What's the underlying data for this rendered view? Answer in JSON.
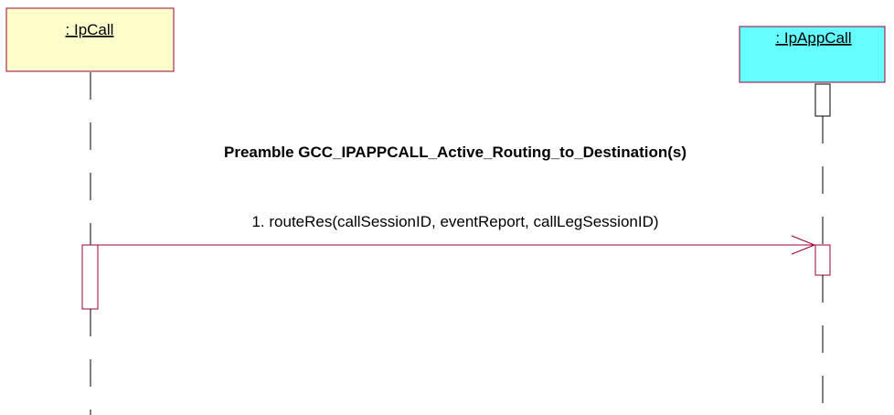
{
  "diagram": {
    "type": "sequence",
    "lifelines": [
      {
        "id": "ipcall",
        "label": ": IpCall",
        "fill_color": "#ffffcc"
      },
      {
        "id": "ipappcall",
        "label": ": IpAppCall",
        "fill_color": "#66ffff"
      }
    ],
    "note": {
      "text": "Preamble GCC_IPAPPCALL_Active_Routing_to_Destination(s)"
    },
    "messages": [
      {
        "label": "1. routeRes(callSessionID, eventReport, callLegSessionID)",
        "from": "ipcall",
        "to": "ipappcall",
        "color": "#990033"
      }
    ]
  }
}
